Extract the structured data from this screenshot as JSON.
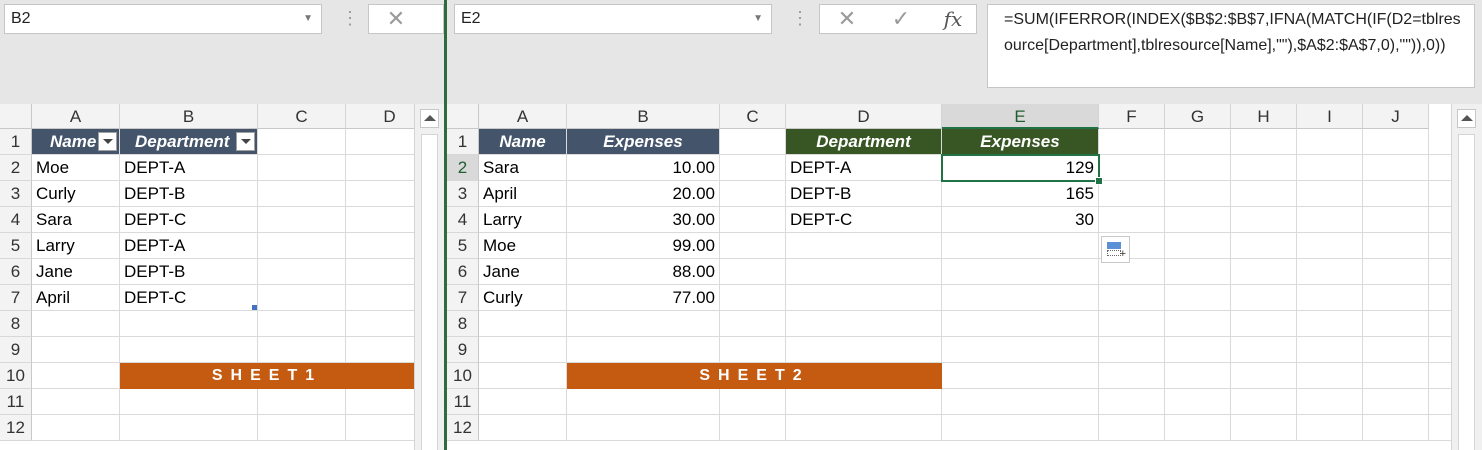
{
  "left": {
    "name_box": "B2",
    "columns": [
      "A",
      "B",
      "C",
      "D"
    ],
    "rows": [
      "1",
      "2",
      "3",
      "4",
      "5",
      "6",
      "7",
      "8",
      "9",
      "10",
      "11",
      "12"
    ],
    "headers": {
      "name": "Name",
      "department": "Department"
    },
    "data": [
      {
        "name": "Moe",
        "dept": "DEPT-A"
      },
      {
        "name": "Curly",
        "dept": "DEPT-B"
      },
      {
        "name": "Sara",
        "dept": "DEPT-C"
      },
      {
        "name": "Larry",
        "dept": "DEPT-A"
      },
      {
        "name": "Jane",
        "dept": "DEPT-B"
      },
      {
        "name": "April",
        "dept": "DEPT-C"
      }
    ],
    "banner": "SHEET1"
  },
  "right": {
    "name_box": "E2",
    "formula": "=SUM(IFERROR(INDEX($B$2:$B$7,IFNA(MATCH(IF(D2=tblresource[Department],tblresource[Name],\"\"),$A$2:$A$7,0),\"\")),0))",
    "fx_label": "fx",
    "columns": [
      "A",
      "B",
      "C",
      "D",
      "E",
      "F",
      "G",
      "H",
      "I",
      "J"
    ],
    "rows": [
      "1",
      "2",
      "3",
      "4",
      "5",
      "6",
      "7",
      "8",
      "9",
      "10",
      "11",
      "12"
    ],
    "headers": {
      "name": "Name",
      "expenses": "Expenses",
      "department": "Department",
      "expenses2": "Expenses"
    },
    "data": [
      {
        "name": "Sara",
        "expense": "10.00"
      },
      {
        "name": "April",
        "expense": "20.00"
      },
      {
        "name": "Larry",
        "expense": "30.00"
      },
      {
        "name": "Moe",
        "expense": "99.00"
      },
      {
        "name": "Jane",
        "expense": "88.00"
      },
      {
        "name": "Curly",
        "expense": "77.00"
      }
    ],
    "summary": [
      {
        "dept": "DEPT-A",
        "total": "129"
      },
      {
        "dept": "DEPT-B",
        "total": "165"
      },
      {
        "dept": "DEPT-C",
        "total": "30"
      }
    ],
    "banner": "SHEET2"
  },
  "colors": {
    "table_header_blue": "#44546a",
    "table_header_green": "#375623",
    "banner_orange": "#c55a11",
    "selection_green": "#217346"
  }
}
